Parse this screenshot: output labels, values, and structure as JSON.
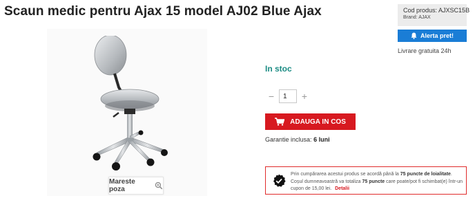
{
  "product": {
    "title": "Scaun medic pentru Ajax 15 model AJ02 Blue Ajax",
    "image_alt": "Scaun medic Ajax AJ02"
  },
  "gallery": {
    "zoom_label": "Mareste poza",
    "zoom_icon": "magnifier-icon"
  },
  "stock": {
    "label": "In stoc",
    "color": "#1c8c84"
  },
  "quantity": {
    "minus": "−",
    "value": "1",
    "plus": "+"
  },
  "cart": {
    "label": "ADAUGA IN COS",
    "icon": "cart-icon",
    "color": "#d71920"
  },
  "warranty": {
    "prefix": "Garantie inclusa:",
    "value": "6 luni"
  },
  "sidebar": {
    "code_label": "Cod produs:",
    "code_value": "AJXSC15B",
    "brand_label": "Brand:",
    "brand_value": "AJAX",
    "alert_label": "Alerta pret!",
    "alert_icon": "bell-icon",
    "alert_color": "#1a7dd6",
    "delivery": "Livrare gratuita 24h"
  },
  "loyalty": {
    "text1": "Prin cumpărarea acestui produs se acordă până la",
    "points1": "75 puncte de loialitate",
    "text2": ". Coșul dumneavoastră va totaliza",
    "points2": "75 puncte",
    "text3": "care poate/pot fi schimbat(e) într-un cupon de 15,00 lei.",
    "details": "Detalii",
    "icon": "checkmark-badge-icon",
    "border_color": "#e02a2a"
  }
}
